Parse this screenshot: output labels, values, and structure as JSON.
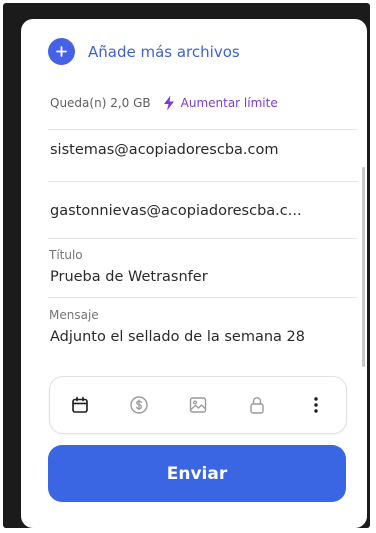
{
  "add_files": {
    "label": "Añade más archivos",
    "icon": "plus-icon"
  },
  "quota": {
    "remaining": "Queda(n) 2,0 GB",
    "upgrade_label": "Aumentar límite",
    "upgrade_icon": "lightning-icon"
  },
  "recipients": [
    "sistemas@acopiadorescba.com",
    "gastonnievas@acopiadorescba.c..."
  ],
  "title_field": {
    "label": "Título",
    "value": "Prueba de Wetrasnfer"
  },
  "message_field": {
    "label": "Mensaje",
    "value": "Adjunto el sellado de la semana 28"
  },
  "toolbar": {
    "icons": [
      "calendar-icon",
      "dollar-icon",
      "image-icon",
      "lock-icon",
      "more-vertical-icon"
    ]
  },
  "send_button": {
    "label": "Enviar"
  },
  "colors": {
    "accent": "#3b66e3",
    "link": "#3f60dc",
    "upgrade": "#7a3bd8",
    "frame": "#1b1b1b"
  }
}
